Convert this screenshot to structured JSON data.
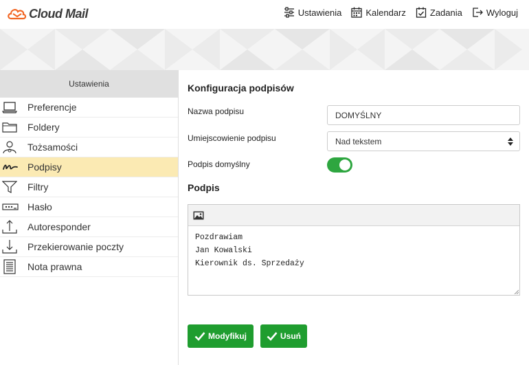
{
  "app": {
    "logo_text": "Cloud Mail"
  },
  "topnav": {
    "settings": "Ustawienia",
    "calendar": "Kalendarz",
    "tasks": "Zadania",
    "logout": "Wyloguj"
  },
  "sidebar": {
    "header": "Ustawienia",
    "items": [
      {
        "label": "Preferencje",
        "icon": "laptop-icon"
      },
      {
        "label": "Foldery",
        "icon": "folder-icon"
      },
      {
        "label": "Tożsamości",
        "icon": "user-icon"
      },
      {
        "label": "Podpisy",
        "icon": "signature-icon"
      },
      {
        "label": "Filtry",
        "icon": "filter-icon"
      },
      {
        "label": "Hasło",
        "icon": "password-icon"
      },
      {
        "label": "Autoresponder",
        "icon": "upload-arrow-icon"
      },
      {
        "label": "Przekierowanie poczty",
        "icon": "download-arrow-icon"
      },
      {
        "label": "Nota prawna",
        "icon": "document-icon"
      }
    ],
    "active_index": 3
  },
  "main": {
    "title": "Konfiguracja podpisów",
    "name_label": "Nazwa podpisu",
    "name_value": "DOMYŚLNY",
    "placement_label": "Umiejscowienie podpisu",
    "placement_value": "Nad tekstem",
    "default_label": "Podpis domyślny",
    "default_on": true,
    "signature_title": "Podpis",
    "signature_lines": [
      "Pozdrawiam",
      "Jan Kowalski",
      "Kierownik ds. Sprzedaży"
    ],
    "modify_button": "Modyfikuj",
    "delete_button": "Usuń"
  },
  "colors": {
    "accent_green": "#1f9d2f",
    "toggle_green": "#2ea640",
    "active_item": "#fbeab3",
    "logo_orange": "#f26522"
  }
}
